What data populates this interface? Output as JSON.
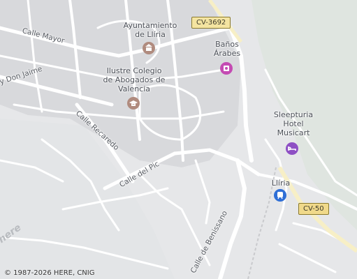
{
  "map": {
    "streets": [
      {
        "label": "Calle Mayor"
      },
      {
        "label": "y Don Jaime"
      },
      {
        "label": "Calle Recaredo"
      },
      {
        "label": "Calle del Pic"
      },
      {
        "label": "Calle de Benissano"
      }
    ],
    "pois": [
      {
        "label_lines": [
          "Ayuntamiento",
          "de Llíria"
        ],
        "icon": "town-hall-icon",
        "color": "#b08b7e"
      },
      {
        "label_lines": [
          "Baños",
          "Árabes"
        ],
        "icon": "museum-icon",
        "color": "#c44bb3"
      },
      {
        "label_lines": [
          "Ilustre Colegio",
          "de Abogados de",
          "Valencia"
        ],
        "icon": "academy-icon",
        "color": "#b08b7e"
      },
      {
        "label_lines": [
          "Sleepturia",
          "Hotel",
          "Musicart"
        ],
        "icon": "hotel-icon",
        "color": "#8e4fc4"
      },
      {
        "label_lines": [
          "Llíria"
        ],
        "icon": "metro-station-icon",
        "color": "#2f6fd6"
      }
    ],
    "road_shields": [
      {
        "label": "CV-3692",
        "color": "#f4e4a1"
      },
      {
        "label": "CV-50",
        "color": "#f0d98a"
      }
    ],
    "logo_text": "here",
    "attribution": "© 1987-2026 HERE, CNIG"
  }
}
